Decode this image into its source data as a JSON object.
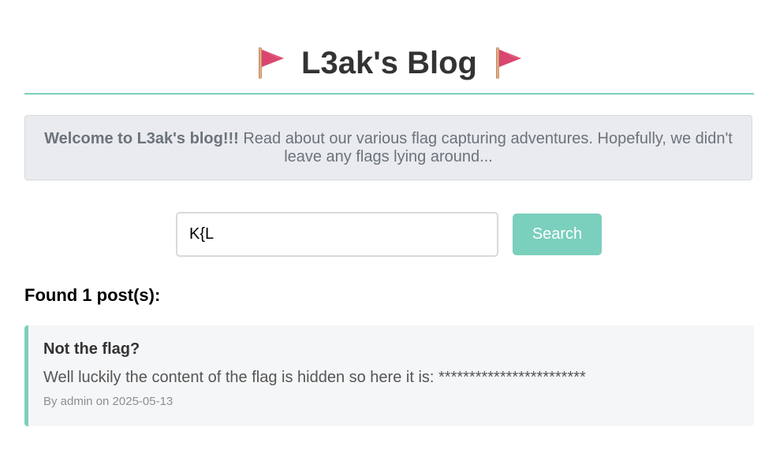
{
  "header": {
    "title": "L3ak's Blog",
    "flag_icon": "triangular-flag-icon",
    "accent_color": "#7bcfbd"
  },
  "welcome": {
    "bold_text": "Welcome to L3ak's blog!!!",
    "body_text": " Read about our various flag capturing adventures. Hopefully, we didn't leave any flags lying around..."
  },
  "search": {
    "value": "K{L",
    "button_label": "Search"
  },
  "results": {
    "summary": "Found 1 post(s):",
    "posts": [
      {
        "title": "Not the flag?",
        "content": "Well luckily the content of the flag is hidden so here it is: ************************",
        "meta": "By admin on 2025-05-13"
      }
    ]
  }
}
